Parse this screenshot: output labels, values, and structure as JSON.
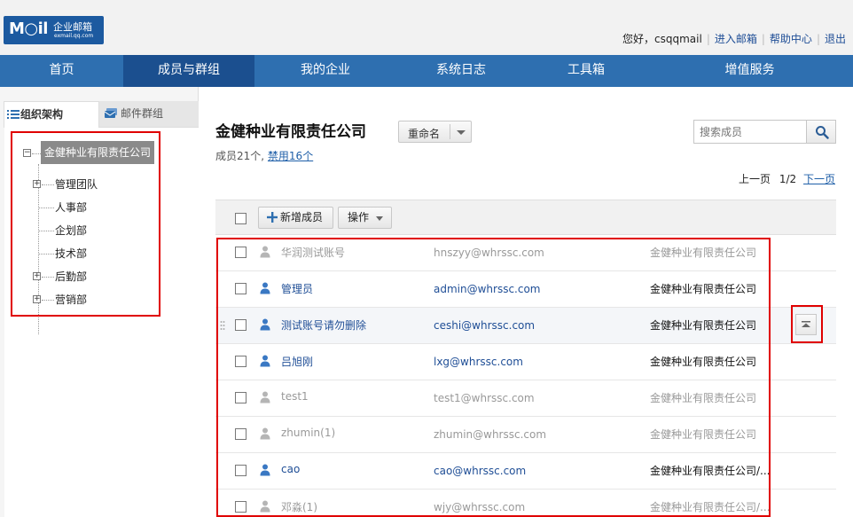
{
  "header": {
    "logo_text": "M○il",
    "logo_cn": "企业邮箱",
    "logo_en": "exmail.qq.com",
    "greeting": "您好，csqqmail",
    "links": [
      "进入邮箱",
      "帮助中心",
      "退出"
    ]
  },
  "nav": {
    "items": [
      "首页",
      "成员与群组",
      "我的企业",
      "系统日志",
      "工具箱",
      "增值服务"
    ],
    "active_index": 1
  },
  "sidebar": {
    "tabs": [
      "组织架构",
      "邮件群组"
    ],
    "root": "金健种业有限责任公司",
    "departments": [
      {
        "label": "管理团队",
        "expandable": true
      },
      {
        "label": "人事部",
        "expandable": false
      },
      {
        "label": "企划部",
        "expandable": false
      },
      {
        "label": "技术部",
        "expandable": false
      },
      {
        "label": "后勤部",
        "expandable": true
      },
      {
        "label": "营销部",
        "expandable": true
      }
    ],
    "expander_plus": "+",
    "expander_minus": "−"
  },
  "main": {
    "company_title": "金健种业有限责任公司",
    "rename_label": "重命名",
    "members_prefix": "成员21个,",
    "members_disabled": "禁用16个",
    "search_placeholder": "搜索成员",
    "pager": {
      "prev": "上一页",
      "page": "1/2",
      "next": "下一页"
    },
    "toolbar": {
      "add_label": "新增成员",
      "operate_label": "操作"
    }
  },
  "members": [
    {
      "name": "华润测试账号",
      "email": "hnszyy@whrssc.com",
      "dept": "金健种业有限责任公司",
      "enabled": false
    },
    {
      "name": "管理员",
      "email": "admin@whrssc.com",
      "dept": "金健种业有限责任公司",
      "enabled": true
    },
    {
      "name": "测试账号请勿删除",
      "email": "ceshi@whrssc.com",
      "dept": "金健种业有限责任公司",
      "enabled": true
    },
    {
      "name": "吕旭刚",
      "email": "lxg@whrssc.com",
      "dept": "金健种业有限责任公司",
      "enabled": true
    },
    {
      "name": "test1",
      "email": "test1@whrssc.com",
      "dept": "金健种业有限责任公司",
      "enabled": false
    },
    {
      "name": "zhumin(1)",
      "email": "zhumin@whrssc.com",
      "dept": "金健种业有限责任公司",
      "enabled": false
    },
    {
      "name": "cao",
      "email": "cao@whrssc.com",
      "dept": "金健种业有限责任公司/...",
      "enabled": true
    },
    {
      "name": "邓淼(1)",
      "email": "wjy@whrssc.com",
      "dept": "金健种业有限责任公司/...",
      "enabled": false
    }
  ],
  "colors": {
    "nav_bg": "#2e6fb0",
    "nav_active": "#1b4f8f",
    "link_blue": "#1f4e96",
    "highlight_red": "#e00000",
    "disabled_gray": "#999999"
  }
}
